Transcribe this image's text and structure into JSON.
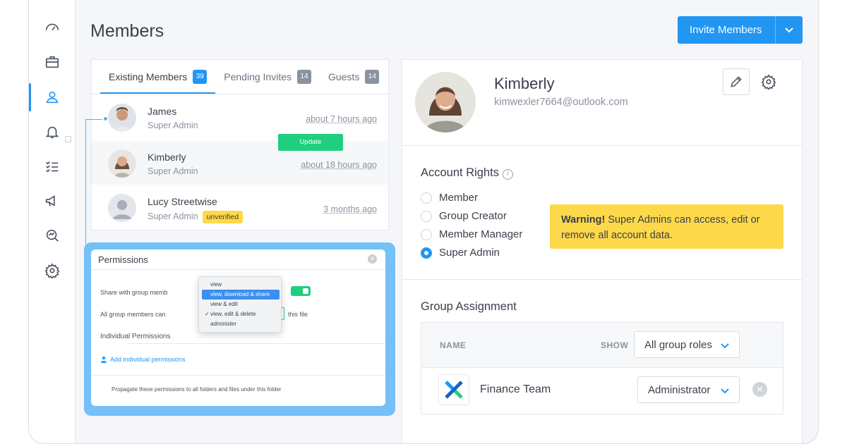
{
  "page": {
    "title": "Members"
  },
  "invite": {
    "label": "Invite Members"
  },
  "tabs": [
    {
      "label": "Existing Members",
      "count": "39"
    },
    {
      "label": "Pending Invites",
      "count": "14"
    },
    {
      "label": "Guests",
      "count": "14"
    }
  ],
  "members": [
    {
      "name": "James",
      "role": "Super Admin",
      "time": "about 7 hours ago"
    },
    {
      "name": "Kimberly",
      "role": "Super Admin",
      "time": "about 18 hours ago"
    },
    {
      "name": "Lucy Streetwise",
      "role": "Super Admin",
      "badge": "unverified",
      "time": "3 months ago"
    }
  ],
  "permissions": {
    "title": "Permissions",
    "share_label": "Share with group memb",
    "all_members_label": "All group members can",
    "this_file": "this file",
    "individual_title": "Individual Permissions",
    "add_individual": "Add individual permissions",
    "propagate_label": "Propagate these permissions to all folders and files under this folder",
    "update_label": "Update",
    "dropdown_options": [
      "view",
      "view, download & share",
      "view & edit",
      "view, edit & delete",
      "administer"
    ],
    "dropdown_highlighted": "view, download & share",
    "dropdown_checked": "view, edit & delete"
  },
  "profile": {
    "name": "Kimberly",
    "email": "kimwexler7664@outlook.com"
  },
  "account_rights": {
    "title": "Account Rights",
    "options": [
      "Member",
      "Group Creator",
      "Member Manager",
      "Super Admin"
    ],
    "selected": "Super Admin"
  },
  "warning": {
    "bold": "Warning!",
    "text": " Super Admins can access, edit or remove all account data."
  },
  "group_assignment": {
    "title": "Group Assignment",
    "col_name": "NAME",
    "col_show": "SHOW",
    "filter": "All group roles",
    "rows": [
      {
        "team": "Finance Team",
        "role": "Administrator"
      }
    ]
  },
  "colors": {
    "accent": "#2196f3",
    "success": "#1fcf7e",
    "warning": "#fdd94a"
  }
}
